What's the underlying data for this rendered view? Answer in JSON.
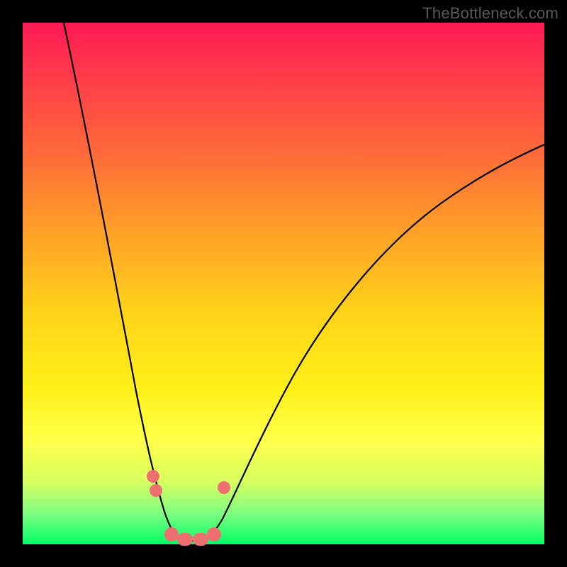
{
  "watermark": "TheBottleneck.com",
  "chart_data": {
    "type": "line",
    "title": "",
    "xlabel": "",
    "ylabel": "",
    "xlim": [
      0,
      100
    ],
    "ylim": [
      0,
      100
    ],
    "series": [
      {
        "name": "bottleneck-curve",
        "x": [
          8,
          10,
          12,
          14,
          16,
          18,
          20,
          22,
          24,
          25,
          27,
          29,
          31,
          33,
          35,
          38,
          42,
          48,
          55,
          62,
          70,
          78,
          86,
          94,
          100
        ],
        "values": [
          100,
          90,
          80,
          70,
          60,
          50,
          41,
          33,
          25,
          18,
          11,
          6,
          2,
          0,
          0,
          2,
          6,
          13,
          22,
          32,
          42,
          52,
          62,
          71,
          78
        ]
      }
    ],
    "markers": [
      {
        "name": "left-cluster-top",
        "x": 23,
        "y": 13
      },
      {
        "name": "left-cluster-mid",
        "x": 24,
        "y": 11
      },
      {
        "name": "right-cluster-top",
        "x": 39,
        "y": 11
      },
      {
        "name": "valley-left",
        "x": 28,
        "y": 1.5
      },
      {
        "name": "valley-midleft",
        "x": 31,
        "y": 0.8
      },
      {
        "name": "valley-mid",
        "x": 34,
        "y": 0.8
      },
      {
        "name": "valley-right",
        "x": 37,
        "y": 1.5
      }
    ],
    "background": "vertical-gradient red→yellow→green",
    "notes": "V-shaped curve with minimum near x≈34%; salmon markers cluster around the valley."
  }
}
